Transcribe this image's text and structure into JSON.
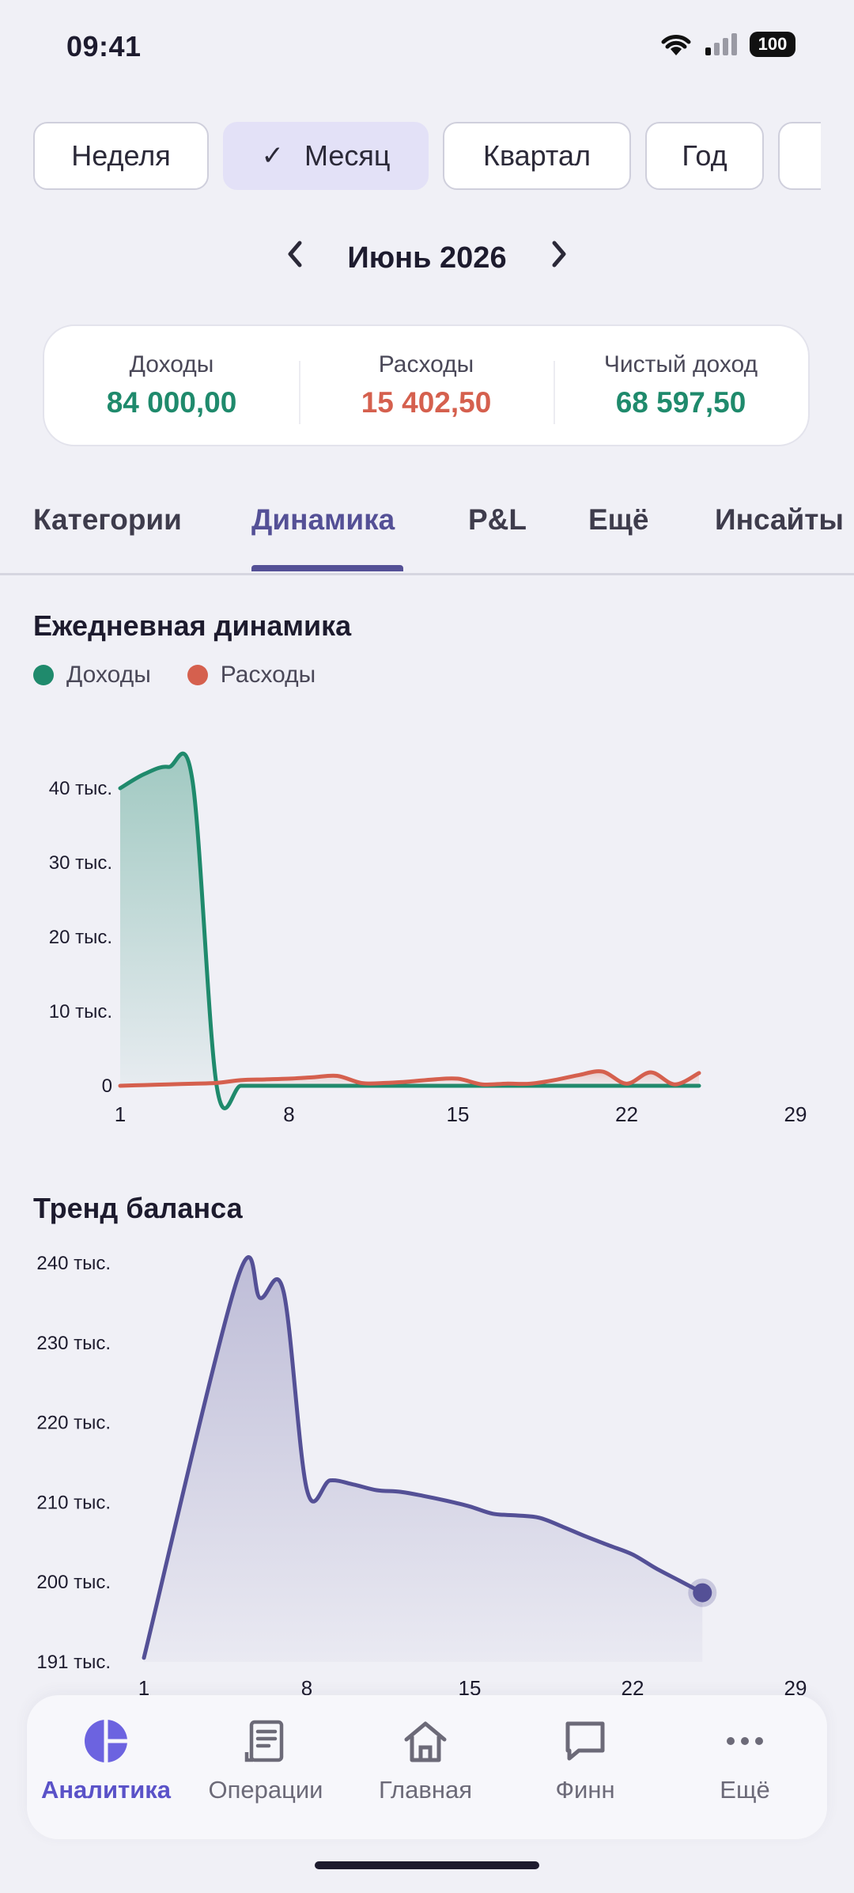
{
  "status_bar": {
    "time": "09:41",
    "battery": "100"
  },
  "periods": [
    {
      "label": "Неделя",
      "selected": false
    },
    {
      "label": "Месяц",
      "selected": true
    },
    {
      "label": "Квартал",
      "selected": false
    },
    {
      "label": "Год",
      "selected": false
    }
  ],
  "month": {
    "label": "Июнь 2026"
  },
  "summary": {
    "income_label": "Доходы",
    "income_value": "84 000,00",
    "expense_label": "Расходы",
    "expense_value": "15 402,50",
    "net_label": "Чистый доход",
    "net_value": "68 597,50"
  },
  "colors": {
    "income": "#1f8a6c",
    "expense": "#d5604e",
    "balance": "#545096",
    "accent": "#5a52c8"
  },
  "tabs": [
    {
      "label": "Категории",
      "active": false
    },
    {
      "label": "Динамика",
      "active": true
    },
    {
      "label": "P&L",
      "active": false
    },
    {
      "label": "Ещё",
      "active": false
    },
    {
      "label": "Инсайты",
      "active": false
    }
  ],
  "chart_data": [
    {
      "type": "line",
      "title": "Ежедневная динамика",
      "x_ticks": [
        "1",
        "8",
        "15",
        "22",
        "29"
      ],
      "y_ticks": [
        "0",
        "10 тыс.",
        "20 тыс.",
        "30 тыс.",
        "40 тыс."
      ],
      "xlim": [
        1,
        29
      ],
      "ylim": [
        0,
        42000
      ],
      "legend": "top-left",
      "series": [
        {
          "name": "Доходы",
          "color": "#1f8a6c",
          "x": [
            1,
            2,
            3,
            4,
            5,
            6,
            7,
            8,
            9,
            10,
            11,
            12,
            13,
            14,
            15,
            16,
            17,
            18,
            19,
            20,
            21,
            22,
            23,
            24,
            25
          ],
          "y": [
            42000,
            44000,
            45000,
            43000,
            0,
            0,
            0,
            0,
            0,
            0,
            0,
            0,
            0,
            0,
            0,
            0,
            0,
            0,
            0,
            0,
            0,
            0,
            0,
            0,
            0
          ]
        },
        {
          "name": "Расходы",
          "color": "#d5604e",
          "x": [
            1,
            2,
            3,
            4,
            5,
            6,
            7,
            8,
            9,
            10,
            11,
            12,
            13,
            14,
            15,
            16,
            17,
            18,
            19,
            20,
            21,
            22,
            23,
            24,
            25
          ],
          "y": [
            0,
            100,
            200,
            300,
            400,
            800,
            900,
            1000,
            1200,
            1400,
            400,
            400,
            600,
            900,
            1000,
            200,
            300,
            300,
            800,
            1500,
            2000,
            300,
            1900,
            200,
            1800
          ]
        }
      ]
    },
    {
      "type": "area",
      "title": "Тренд баланса",
      "x_ticks": [
        "1",
        "8",
        "15",
        "22",
        "29"
      ],
      "y_ticks": [
        "191 тыс.",
        "200 тыс.",
        "210 тыс.",
        "220 тыс.",
        "230 тыс.",
        "240 тыс."
      ],
      "xlim": [
        1,
        29
      ],
      "ylim": [
        191000,
        240000
      ],
      "series": [
        {
          "name": "Баланс",
          "color": "#545096",
          "x": [
            1,
            5,
            6,
            7,
            8,
            9,
            10,
            11,
            12,
            13,
            14,
            15,
            16,
            17,
            18,
            19,
            20,
            21,
            22,
            23,
            24,
            25
          ],
          "y": [
            191500,
            237900,
            235700,
            236500,
            212200,
            213300,
            212800,
            212100,
            211900,
            211400,
            210800,
            210100,
            209200,
            209000,
            208700,
            207600,
            206400,
            205300,
            204200,
            202500,
            201000,
            199500
          ]
        }
      ]
    }
  ],
  "bottom_nav": [
    {
      "label": "Аналитика",
      "icon": "pie-chart-icon",
      "active": true
    },
    {
      "label": "Операции",
      "icon": "receipt-icon",
      "active": false
    },
    {
      "label": "Главная",
      "icon": "home-icon",
      "active": false
    },
    {
      "label": "Финн",
      "icon": "chat-icon",
      "active": false
    },
    {
      "label": "Ещё",
      "icon": "more-icon",
      "active": false
    }
  ]
}
